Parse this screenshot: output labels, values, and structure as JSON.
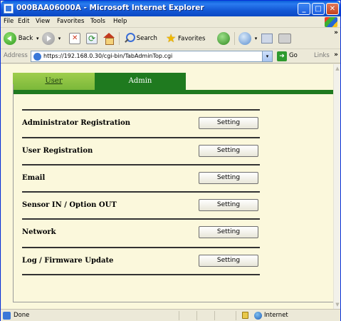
{
  "window": {
    "title": "000BAA06000A - Microsoft Internet Explorer",
    "minimize_glyph": "_",
    "maximize_glyph": "□",
    "close_glyph": "✕"
  },
  "menu": [
    "File",
    "Edit",
    "View",
    "Favorites",
    "Tools",
    "Help"
  ],
  "toolbar": {
    "back_label": "Back",
    "search_label": "Search",
    "favorites_label": "Favorites",
    "dropdown_glyph": "▾",
    "more_glyph": "»"
  },
  "address": {
    "label": "Address",
    "url": "https://192.168.0.30/cgi-bin/TabAdminTop.cgi",
    "go_label": "Go",
    "links_label": "Links",
    "more_glyph": "»"
  },
  "tabs": [
    {
      "label": "User",
      "active": false
    },
    {
      "label": "Admin",
      "active": true
    }
  ],
  "settings_rows": [
    {
      "label": "Administrator Registration",
      "button": "Setting"
    },
    {
      "label": "User Registration",
      "button": "Setting"
    },
    {
      "label": "Email",
      "button": "Setting"
    },
    {
      "label": "Sensor IN / Option OUT",
      "button": "Setting"
    },
    {
      "label": "Network",
      "button": "Setting"
    },
    {
      "label": "Log / Firmware Update",
      "button": "Setting"
    }
  ],
  "status": {
    "text": "Done",
    "zone": "Internet"
  },
  "colors": {
    "title_bar": "#1459d6",
    "tab_user": "#8cc43f",
    "tab_admin": "#1f7a1f",
    "content_bg": "#fbf8dc"
  }
}
